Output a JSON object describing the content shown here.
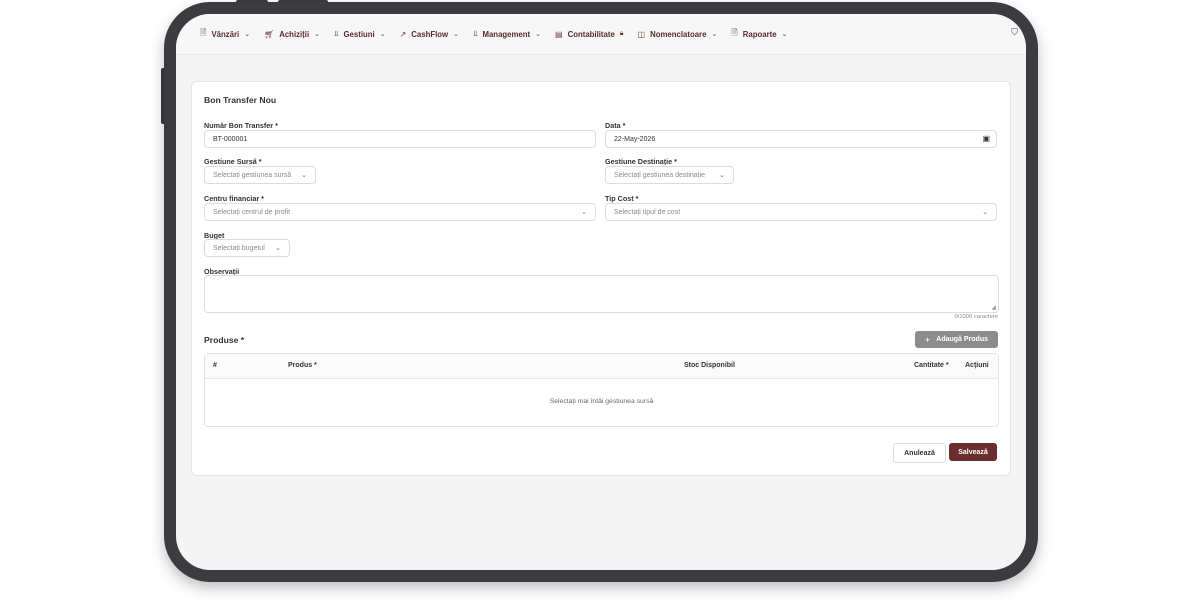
{
  "nav": {
    "items": [
      {
        "label": "Vânzări",
        "icon": "document-icon",
        "glyph": "🗎"
      },
      {
        "label": "Achiziții",
        "icon": "cart-icon",
        "glyph": "⛟"
      },
      {
        "label": "Gestiuni",
        "icon": "bar-chart-icon",
        "glyph": "⫫"
      },
      {
        "label": "CashFlow",
        "icon": "trend-icon",
        "glyph": "↗"
      },
      {
        "label": "Management",
        "icon": "bar-chart-icon",
        "glyph": "⫫"
      },
      {
        "label": "Contabilitate",
        "icon": "clipboard-icon",
        "glyph": "▤"
      },
      {
        "label": "Nomenclatoare",
        "icon": "book-icon",
        "glyph": "◫"
      },
      {
        "label": "Rapoarte",
        "icon": "document-icon",
        "glyph": "🗎"
      }
    ]
  },
  "form": {
    "title": "Bon Transfer Nou",
    "numar_label": "Număr Bon Transfer *",
    "numar_value": "BT-000001",
    "data_label": "Data *",
    "data_value": "22-May-2026",
    "gest_sursa_label": "Gestiune Sursă *",
    "gest_sursa_placeholder": "Selectați gestiunea sursă",
    "gest_dest_label": "Gestiune Destinație *",
    "gest_dest_placeholder": "Selectați gestiunea destinație",
    "centru_label": "Centru financiar *",
    "centru_placeholder": "Selectați centrul de profit",
    "tip_cost_label": "Tip Cost *",
    "tip_cost_placeholder": "Selectați tipul de cost",
    "buget_label": "Buget",
    "buget_placeholder": "Selectați bugetul",
    "obs_label": "Observații",
    "obs_counter": "0/1000 caractere"
  },
  "products": {
    "title": "Produse *",
    "add_label": "Adaugă Produs",
    "columns": [
      "#",
      "Produs *",
      "Stoc Disponibil",
      "Cantitate *",
      "Acțiuni"
    ],
    "empty_message": "Selectați mai întâi gestiunea sursă"
  },
  "actions": {
    "cancel": "Anulează",
    "save": "Salvează"
  },
  "colors": {
    "accent": "#6b2e2e",
    "nav_text": "#5b2a2a",
    "add_button": "#8c8c8c"
  }
}
